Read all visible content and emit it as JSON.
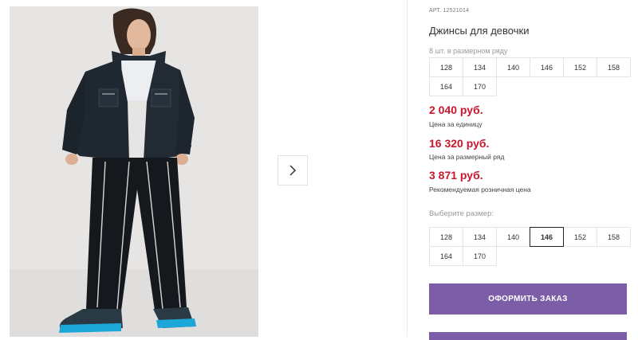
{
  "product": {
    "article_label": "АРТ.",
    "article_number": "12521014",
    "title": "Джинсы для девочки",
    "series_label": "8 шт. в размерном ряду",
    "series_sizes": [
      "128",
      "134",
      "140",
      "146",
      "152",
      "158",
      "164",
      "170"
    ],
    "prices": [
      {
        "amount": "2 040 руб.",
        "note": "Цена за единицу"
      },
      {
        "amount": "16 320 руб.",
        "note": "Цена за размерный ряд"
      },
      {
        "amount": "3 871 руб.",
        "note": "Рекомендуемая розничная цена"
      }
    ],
    "choose_size_label": "Выберите размер:",
    "size_options": [
      "128",
      "134",
      "140",
      "146",
      "152",
      "158",
      "164",
      "170"
    ],
    "selected_size": "146",
    "order_button_label": "ОФОРМИТЬ ЗАКАЗ"
  },
  "colors": {
    "price": "#c8172d",
    "accent": "#7b5ea7"
  },
  "icons": {
    "next": "chevron-right-icon"
  }
}
